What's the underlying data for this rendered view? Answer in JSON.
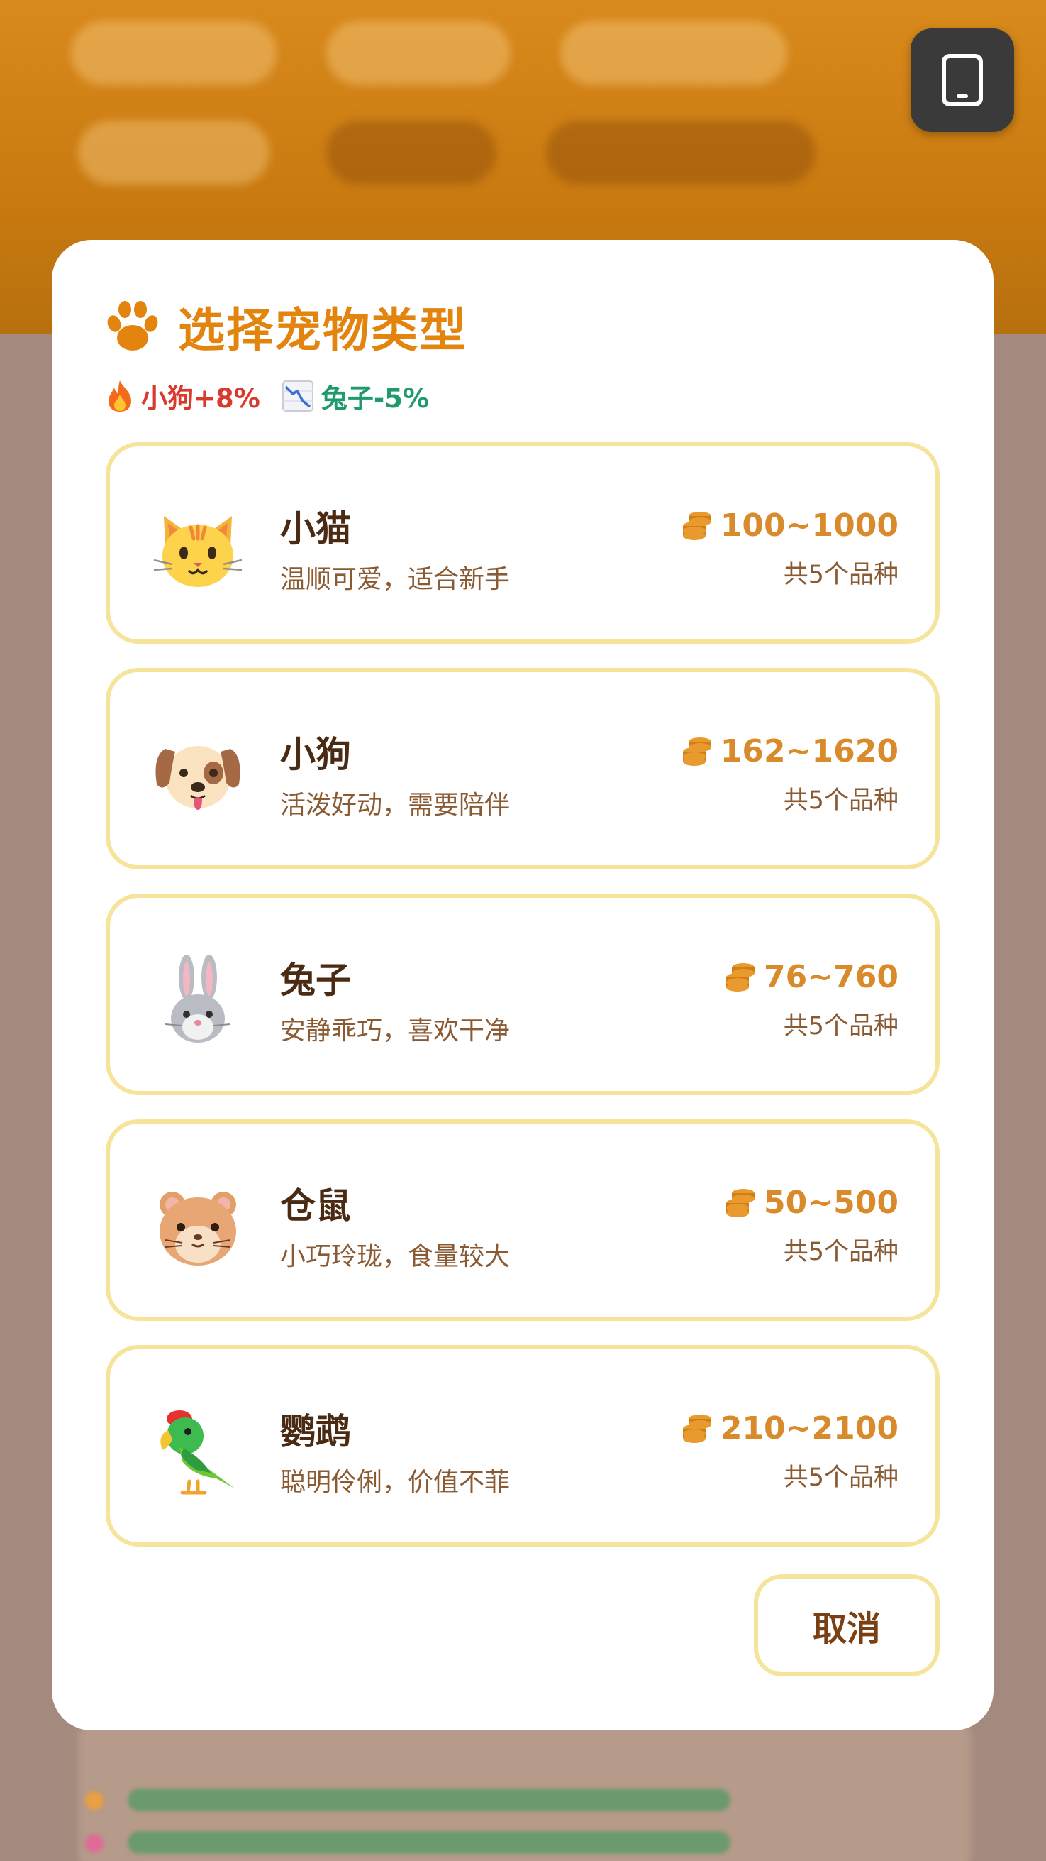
{
  "modal": {
    "title": "选择宠物类型",
    "trends": [
      {
        "label": "小狗+8%",
        "direction": "up",
        "icon": "fire-icon"
      },
      {
        "label": "兔子-5%",
        "direction": "down",
        "icon": "chart-down-icon"
      }
    ],
    "pets": [
      {
        "name": "小猫",
        "desc": "温顺可爱，适合新手",
        "price": "100~1000",
        "breeds": "共5个品种",
        "icon": "cat-face-icon"
      },
      {
        "name": "小狗",
        "desc": "活泼好动，需要陪伴",
        "price": "162~1620",
        "breeds": "共5个品种",
        "icon": "dog-face-icon"
      },
      {
        "name": "兔子",
        "desc": "安静乖巧，喜欢干净",
        "price": "76~760",
        "breeds": "共5个品种",
        "icon": "rabbit-face-icon"
      },
      {
        "name": "仓鼠",
        "desc": "小巧玲珑，食量较大",
        "price": "50~500",
        "breeds": "共5个品种",
        "icon": "hamster-face-icon"
      },
      {
        "name": "鹦鹉",
        "desc": "聪明伶俐，价值不菲",
        "price": "210~2100",
        "breeds": "共5个品种",
        "icon": "parrot-icon"
      }
    ],
    "cancel_label": "取消"
  },
  "colors": {
    "accent": "#e3840f",
    "card_border": "#f6e49a",
    "trend_up": "#d93a2e",
    "trend_down": "#1f9a6a",
    "price": "#d98a2b",
    "dark_text": "#4a2a12"
  }
}
